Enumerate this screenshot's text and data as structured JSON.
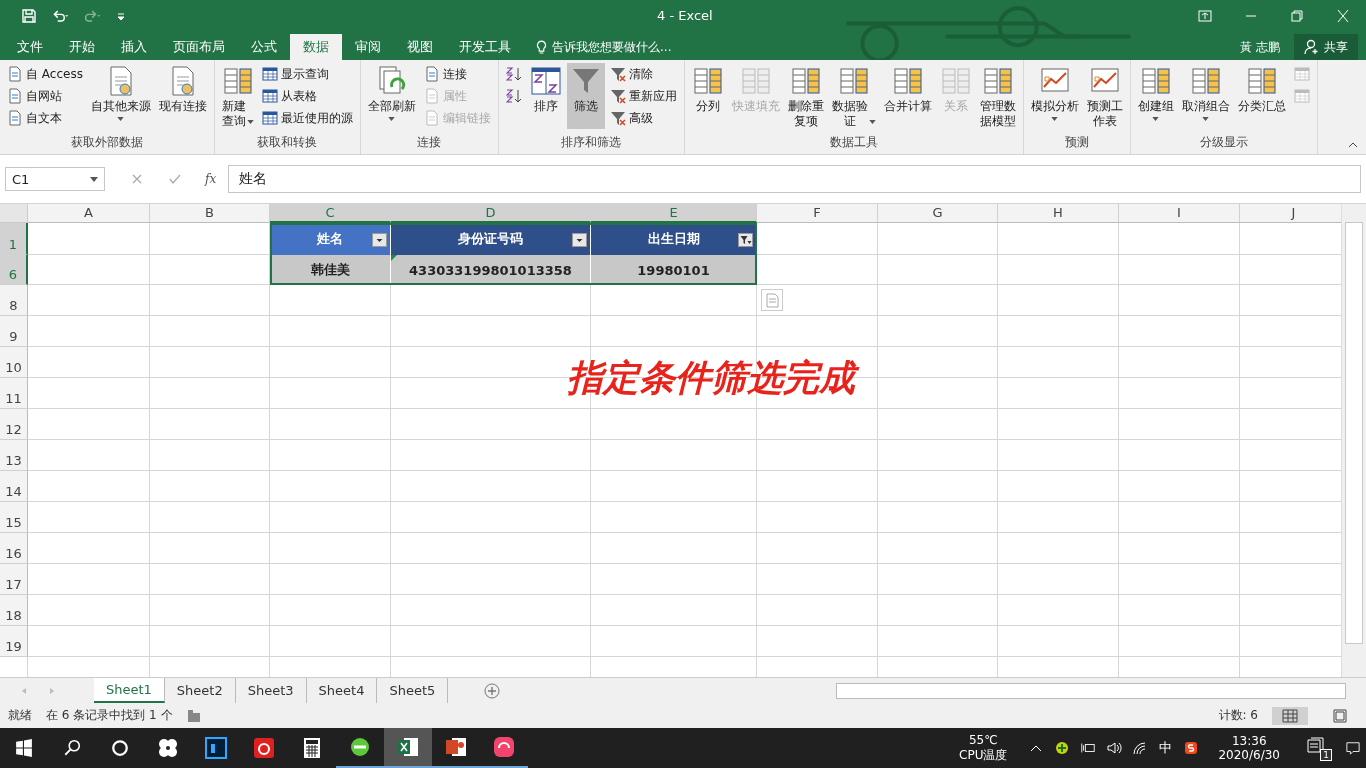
{
  "window": {
    "title": "4 - Excel",
    "user": "黃 志鹏",
    "share": "共享"
  },
  "quick_access": [
    {
      "kind": "save",
      "disabled": false
    },
    {
      "kind": "undo",
      "disabled": false
    },
    {
      "kind": "redo",
      "disabled": true
    },
    {
      "kind": "customize",
      "disabled": false
    }
  ],
  "tabs": [
    {
      "label": "文件",
      "selected": false
    },
    {
      "label": "开始",
      "selected": false
    },
    {
      "label": "插入",
      "selected": false
    },
    {
      "label": "页面布局",
      "selected": false
    },
    {
      "label": "公式",
      "selected": false
    },
    {
      "label": "数据",
      "selected": true
    },
    {
      "label": "审阅",
      "selected": false
    },
    {
      "label": "视图",
      "selected": false
    },
    {
      "label": "开发工具",
      "selected": false
    }
  ],
  "tell_me": "告诉我您想要做什么...",
  "ribbon": [
    {
      "label": "获取外部数据",
      "columns": [
        [
          {
            "label": "自 Access",
            "kind": "small",
            "disabled": false,
            "pressed": false
          },
          {
            "label": "自网站",
            "kind": "small",
            "disabled": false,
            "pressed": false
          },
          {
            "label": "自文本",
            "kind": "small",
            "disabled": false,
            "pressed": false
          }
        ],
        [
          {
            "label": "自其他来源",
            "kind": "large",
            "disabled": false,
            "pressed": false,
            "caret": true
          }
        ],
        [
          {
            "label": "现有连接",
            "kind": "large",
            "disabled": false,
            "pressed": false
          }
        ]
      ]
    },
    {
      "label": "获取和转换",
      "columns": [
        [
          {
            "label": "新建查询",
            "kind": "large",
            "disabled": false,
            "pressed": false,
            "caret": true
          }
        ],
        [
          {
            "label": "显示查询",
            "kind": "small",
            "disabled": false,
            "pressed": false
          },
          {
            "label": "从表格",
            "kind": "small",
            "disabled": false,
            "pressed": false
          },
          {
            "label": "最近使用的源",
            "kind": "small",
            "disabled": false,
            "pressed": false
          }
        ]
      ]
    },
    {
      "label": "连接",
      "columns": [
        [
          {
            "label": "全部刷新",
            "kind": "large",
            "disabled": false,
            "pressed": false,
            "caret": true
          }
        ],
        [
          {
            "label": "连接",
            "kind": "small",
            "disabled": false,
            "pressed": false
          },
          {
            "label": "属性",
            "kind": "small",
            "disabled": true,
            "pressed": false
          },
          {
            "label": "编辑链接",
            "kind": "small",
            "disabled": true,
            "pressed": false
          }
        ]
      ]
    },
    {
      "label": "排序和筛选",
      "columns": [
        [
          {
            "kind": "small",
            "disabled": false,
            "pressed": false
          },
          {
            "kind": "small",
            "disabled": false,
            "pressed": false
          }
        ],
        [
          {
            "label": "排序",
            "kind": "large",
            "disabled": false,
            "pressed": false
          }
        ],
        [
          {
            "label": "筛选",
            "kind": "large",
            "disabled": false,
            "pressed": true
          }
        ],
        [
          {
            "label": "清除",
            "kind": "small",
            "disabled": false,
            "pressed": false
          },
          {
            "label": "重新应用",
            "kind": "small",
            "disabled": false,
            "pressed": false
          },
          {
            "label": "高级",
            "kind": "small",
            "disabled": false,
            "pressed": false
          }
        ]
      ]
    },
    {
      "label": "数据工具",
      "columns": [
        [
          {
            "label": "分列",
            "kind": "large",
            "disabled": false,
            "pressed": false
          }
        ],
        [
          {
            "label": "快速填充",
            "kind": "large",
            "disabled": true,
            "pressed": false
          }
        ],
        [
          {
            "label": "删除重复项",
            "kind": "large",
            "disabled": false,
            "pressed": false
          }
        ],
        [
          {
            "label": "数据验证",
            "kind": "large",
            "disabled": false,
            "pressed": false,
            "caret": true
          }
        ],
        [
          {
            "label": "合并计算",
            "kind": "large",
            "disabled": false,
            "pressed": false
          }
        ],
        [
          {
            "label": "关系",
            "kind": "large",
            "disabled": true,
            "pressed": false
          }
        ],
        [
          {
            "label": "管理数据模型",
            "kind": "large",
            "disabled": false,
            "pressed": false
          }
        ]
      ]
    },
    {
      "label": "预测",
      "columns": [
        [
          {
            "label": "模拟分析",
            "kind": "large",
            "disabled": false,
            "pressed": false,
            "caret": true
          }
        ],
        [
          {
            "label": "预测工作表",
            "kind": "large",
            "disabled": false,
            "pressed": false
          }
        ]
      ]
    },
    {
      "label": "分级显示",
      "columns": [
        [
          {
            "label": "创建组",
            "kind": "large",
            "disabled": false,
            "pressed": false,
            "caret": true
          }
        ],
        [
          {
            "label": "取消组合",
            "kind": "large",
            "disabled": false,
            "pressed": false,
            "caret": true
          }
        ],
        [
          {
            "label": "分类汇总",
            "kind": "large",
            "disabled": false,
            "pressed": false
          }
        ],
        [
          {
            "kind": "small",
            "disabled": true,
            "pressed": false
          },
          {
            "kind": "small",
            "disabled": true,
            "pressed": false
          }
        ]
      ]
    }
  ],
  "formula_bar": {
    "name_box": "C1",
    "function_label": "fx",
    "value": "姓名"
  },
  "columns": [
    {
      "label": "A",
      "selected": false
    },
    {
      "label": "B",
      "selected": false
    },
    {
      "label": "C",
      "selected": true
    },
    {
      "label": "D",
      "selected": true
    },
    {
      "label": "E",
      "selected": true
    },
    {
      "label": "F",
      "selected": false
    },
    {
      "label": "G",
      "selected": false
    },
    {
      "label": "H",
      "selected": false
    },
    {
      "label": "I",
      "selected": false
    },
    {
      "label": "J",
      "selected": false
    }
  ],
  "rows": [
    {
      "label": "1",
      "selected": true
    },
    {
      "label": "6",
      "selected": true
    },
    {
      "label": "8",
      "selected": false
    },
    {
      "label": "9",
      "selected": false
    },
    {
      "label": "10",
      "selected": false
    },
    {
      "label": "11",
      "selected": false
    },
    {
      "label": "12",
      "selected": false
    },
    {
      "label": "13",
      "selected": false
    },
    {
      "label": "14",
      "selected": false
    },
    {
      "label": "15",
      "selected": false
    },
    {
      "label": "16",
      "selected": false
    },
    {
      "label": "17",
      "selected": false
    },
    {
      "label": "18",
      "selected": false
    },
    {
      "label": "19",
      "selected": false
    }
  ],
  "table": {
    "headers": [
      {
        "text": "姓名",
        "filter_active": false,
        "active": true
      },
      {
        "text": "身份证号码",
        "filter_active": false,
        "active": false
      },
      {
        "text": "出生日期",
        "filter_active": true,
        "active": false
      }
    ],
    "rows": [
      [
        {
          "text": "韩佳美",
          "flagged": false
        },
        {
          "text": "433033199801013358",
          "flagged": true
        },
        {
          "text": "19980101",
          "flagged": false
        }
      ]
    ]
  },
  "overlay_caption": "指定条件筛选完成",
  "sheets": [
    {
      "label": "Sheet1",
      "selected": true
    },
    {
      "label": "Sheet2",
      "selected": false
    },
    {
      "label": "Sheet3",
      "selected": false
    },
    {
      "label": "Sheet4",
      "selected": false
    },
    {
      "label": "Sheet5",
      "selected": false
    }
  ],
  "status_bar": {
    "mode": "就绪",
    "message": "在 6 条记录中找到 1 个",
    "count": "计数: 6"
  },
  "taskbar": {
    "apps": [
      {
        "kind": "fan",
        "running": false,
        "selected": false
      },
      {
        "kind": "design",
        "running": false,
        "selected": false
      },
      {
        "kind": "music",
        "running": false,
        "selected": false
      },
      {
        "kind": "calculator",
        "running": false,
        "selected": false
      },
      {
        "kind": "browser",
        "running": true,
        "selected": false
      },
      {
        "kind": "sheet",
        "running": true,
        "selected": true
      },
      {
        "kind": "slides",
        "running": true,
        "selected": false
      },
      {
        "kind": "pink",
        "running": true,
        "selected": false
      }
    ],
    "temperature": "55℃",
    "temperature_label": "CPU温度",
    "ime": "中",
    "time": "13:36",
    "date": "2020/6/30",
    "notifications": "1"
  }
}
